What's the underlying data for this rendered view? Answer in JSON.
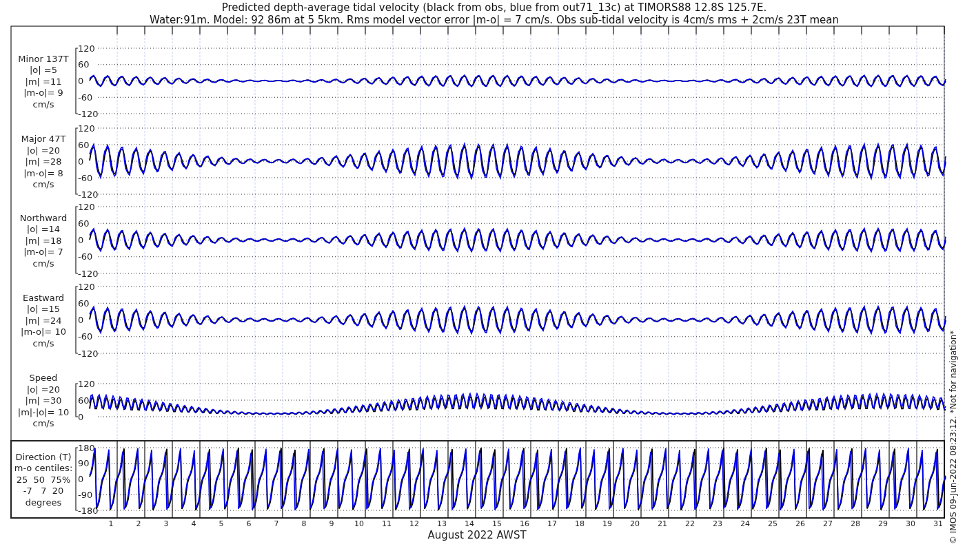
{
  "title_lines": [
    "Predicted depth-average tidal velocity (black from obs, blue from out71_13c) at TIMORS88 12.8S 125.7E.",
    "Water:91m. Model: 92 86m at 5 5km. Rms model vector error |m-o| = 7 cm/s. Obs sub-tidal velocity is 4cm/s rms + 2cm/s 23T mean"
  ],
  "panels": [
    {
      "kind": "velocity",
      "label_lines": [
        "Minor 137T",
        "|o| =5",
        "|m| =11",
        "|m-o|= 9",
        "cm/s"
      ],
      "yticks": [
        "120",
        "60",
        "0",
        "-60",
        "-120"
      ]
    },
    {
      "kind": "velocity",
      "label_lines": [
        "Major 47T",
        "|o| =20",
        "|m| =28",
        "|m-o|= 8",
        "cm/s"
      ],
      "yticks": [
        "120",
        "60",
        "0",
        "-60",
        "-120"
      ]
    },
    {
      "kind": "velocity",
      "label_lines": [
        "Northward",
        "|o| =14",
        "|m| =18",
        "|m-o|= 7",
        "cm/s"
      ],
      "yticks": [
        "120",
        "60",
        "0",
        "-60",
        "-120"
      ]
    },
    {
      "kind": "velocity",
      "label_lines": [
        "Eastward",
        "|o| =15",
        "|m| =24",
        "|m-o|= 10",
        "cm/s"
      ],
      "yticks": [
        "120",
        "60",
        "0",
        "-60",
        "-120"
      ]
    },
    {
      "kind": "speed",
      "label_lines": [
        "Speed",
        "|o| =20",
        "|m| =30",
        "|m|-|o|= 10",
        "cm/s"
      ],
      "yticks": [
        "120",
        "60",
        "0"
      ]
    },
    {
      "kind": "direction",
      "label_lines": [
        "Direction (T)",
        "m-o centiles:",
        "25  50  75%",
        "-7   7  20",
        "degrees"
      ],
      "yticks": [
        "180",
        "90",
        "0",
        "-90",
        "-180"
      ]
    }
  ],
  "x_axis": {
    "day_labels": [
      "1",
      "2",
      "3",
      "4",
      "5",
      "6",
      "7",
      "8",
      "9",
      "10",
      "11",
      "12",
      "13",
      "14",
      "15",
      "16",
      "17",
      "18",
      "19",
      "20",
      "21",
      "22",
      "23",
      "24",
      "25",
      "26",
      "27",
      "28",
      "29",
      "30",
      "31"
    ],
    "xlabel": "August 2022 AWST"
  },
  "side_note": "© IMOS 09-Jun-2022 08:23:12. *Not for navigation*"
}
